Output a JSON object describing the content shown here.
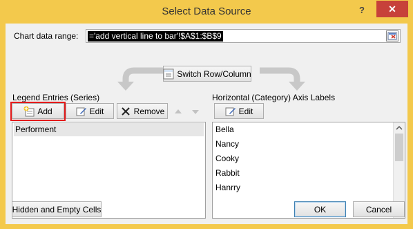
{
  "window": {
    "title": "Select Data Source",
    "help_icon": "?",
    "close_icon": "✕"
  },
  "range": {
    "label": "Chart data range:",
    "value": "='add vertical line to bar'!$A$1:$B$9"
  },
  "switch_button": "Switch Row/Column",
  "legend": {
    "label": "Legend Entries (Series)",
    "add": "Add",
    "edit": "Edit",
    "remove": "Remove",
    "items": [
      "Performent"
    ]
  },
  "axis": {
    "label": "Horizontal (Category) Axis Labels",
    "edit": "Edit",
    "items": [
      "Bella",
      "Nancy",
      "Cooky",
      "Rabbit",
      "Hanrry"
    ]
  },
  "footer": {
    "hidden_empty": "Hidden and Empty Cells",
    "ok": "OK",
    "cancel": "Cancel"
  },
  "colors": {
    "title_bar": "#f3c94c",
    "close_button": "#c7413a",
    "highlight_outline": "#e41b1b",
    "selected_row": "#e6e6e6"
  }
}
